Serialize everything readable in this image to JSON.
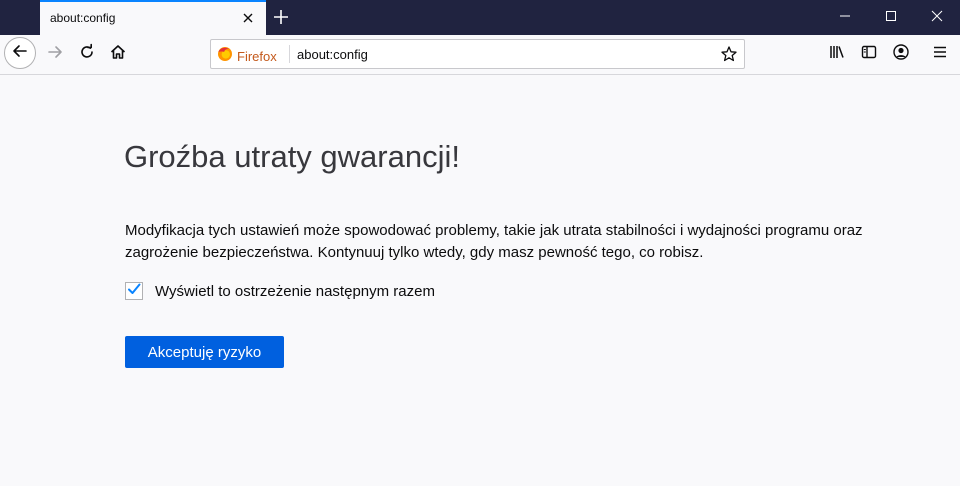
{
  "tab": {
    "title": "about:config"
  },
  "urlbar": {
    "identity_label": "Firefox",
    "url": "about:config"
  },
  "icons": {
    "back": "arrow-left-icon",
    "forward": "arrow-right-icon",
    "reload": "reload-icon",
    "home": "home-icon",
    "bookmark": "star-icon",
    "library": "library-icon",
    "sidebar": "sidebar-icon",
    "account": "account-icon",
    "menu": "hamburger-menu-icon",
    "minimize": "minimize-icon",
    "maximize": "maximize-icon",
    "close": "close-icon",
    "new_tab": "plus-icon"
  },
  "colors": {
    "titlebar": "#202340",
    "accent": "#0a84ff",
    "primary_button": "#0060df",
    "checkbox_check": "#0a84ff"
  },
  "warning": {
    "title": "Groźba utraty gwarancji!",
    "description": "Modyfikacja tych ustawień może spowodować problemy, takie jak utrata stabilności i wydajności programu oraz zagrożenie bezpieczeństwa. Kontynuuj tylko wtedy, gdy masz pewność tego, co robisz.",
    "checkbox_label": "Wyświetl to ostrzeżenie następnym razem",
    "checkbox_checked": true,
    "accept_button": "Akceptuję ryzyko"
  }
}
